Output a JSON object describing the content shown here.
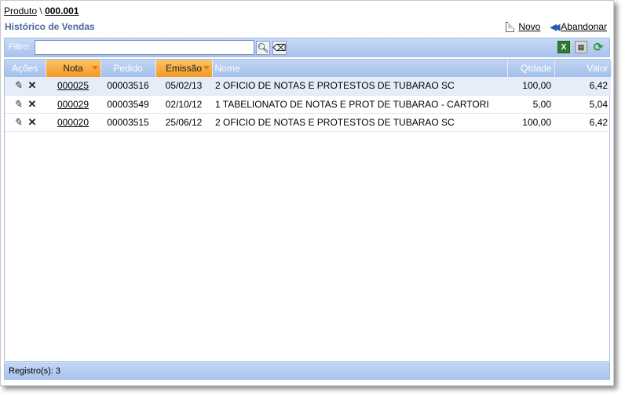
{
  "breadcrumb": {
    "parent": "Produto",
    "separator": "\\",
    "code": "000.001"
  },
  "page_title": "Histórico de Vendas",
  "actions": {
    "new_label": "Novo",
    "abandon_label": "Abandonar"
  },
  "filter": {
    "label": "Filtro:",
    "value": "",
    "placeholder": ""
  },
  "columns": {
    "acoes": "Ações",
    "nota": "Nota",
    "pedido": "Pedido",
    "emissao": "Emissão",
    "nome": "Nome",
    "qtdade": "Qtdade",
    "valor": "Valor"
  },
  "rows": [
    {
      "nota": "000025",
      "pedido": "00003516",
      "emissao": "05/02/13",
      "nome": "2 OFICIO DE NOTAS E PROTESTOS DE TUBARAO SC",
      "qtdade": "100,00",
      "valor": "6,42"
    },
    {
      "nota": "000029",
      "pedido": "00003549",
      "emissao": "02/10/12",
      "nome": "1 TABELIONATO DE NOTAS E PROT DE TUBARAO - CARTORI",
      "qtdade": "5,00",
      "valor": "5,04"
    },
    {
      "nota": "000020",
      "pedido": "00003515",
      "emissao": "25/06/12",
      "nome": "2 OFICIO DE NOTAS E PROTESTOS DE TUBARAO SC",
      "qtdade": "100,00",
      "valor": "6,42"
    }
  ],
  "status": {
    "label": "Registro(s): 3"
  },
  "colors": {
    "header_blue": "#a3bfec",
    "sorted_orange": "#f39a22",
    "title_blue": "#4a6a9a",
    "selected_row": "#e6edf9"
  }
}
